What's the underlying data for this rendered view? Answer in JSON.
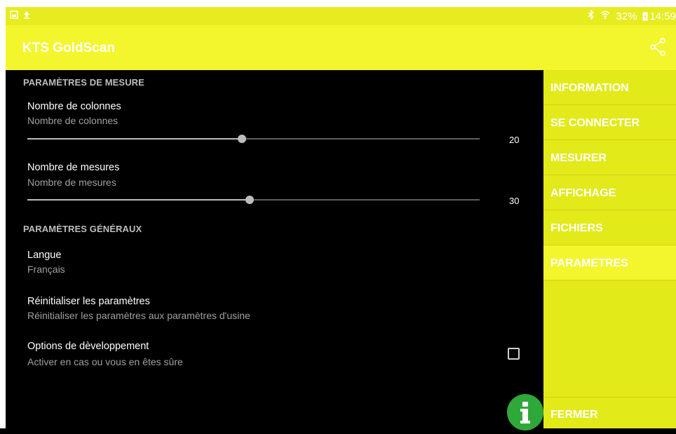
{
  "status_bar": {
    "battery": "32%",
    "time": "14:59",
    "icons": [
      "gallery-icon",
      "upload-icon",
      "bluetooth-icon",
      "wifi-icon",
      "battery-charging-icon"
    ]
  },
  "app_bar": {
    "title": "KTS GoldScan",
    "share_icon": "share-icon"
  },
  "settings": {
    "measure_section": "PARAMÈTRES DE MESURE",
    "columns": {
      "title": "Nombre de colonnes",
      "summary": "Nombre de colonnes",
      "value": "20",
      "fraction": 0.474
    },
    "measures": {
      "title": "Nombre de mesures",
      "summary": "Nombre de mesures",
      "value": "30",
      "fraction": 0.491
    },
    "general_section": "PARAMÈTRES GÉNÉRAUX",
    "language": {
      "title": "Langue",
      "summary": "Français"
    },
    "reset": {
      "title": "Réinitialiser les paramètres",
      "summary": "Réinitialiser les paramètres aux paramètres d'usine"
    },
    "dev_options": {
      "title": "Options de dèveloppement",
      "summary": "Activer en cas ou vous en êtes sûre",
      "checked": false
    }
  },
  "fab": {
    "icon": "info-icon"
  },
  "menu": {
    "items": [
      {
        "label": "INFORMATION"
      },
      {
        "label": "SE CONNECTER"
      },
      {
        "label": "MESURER"
      },
      {
        "label": "AFFICHAGE"
      },
      {
        "label": "FICHIERS"
      },
      {
        "label": "PARAMETRES"
      }
    ],
    "selected": "PARAMETRES",
    "close_label": "FERMER"
  },
  "colors": {
    "accent": "#f4f62d",
    "menu_bg": "#e3ea19",
    "fab": "#2fa83a"
  }
}
